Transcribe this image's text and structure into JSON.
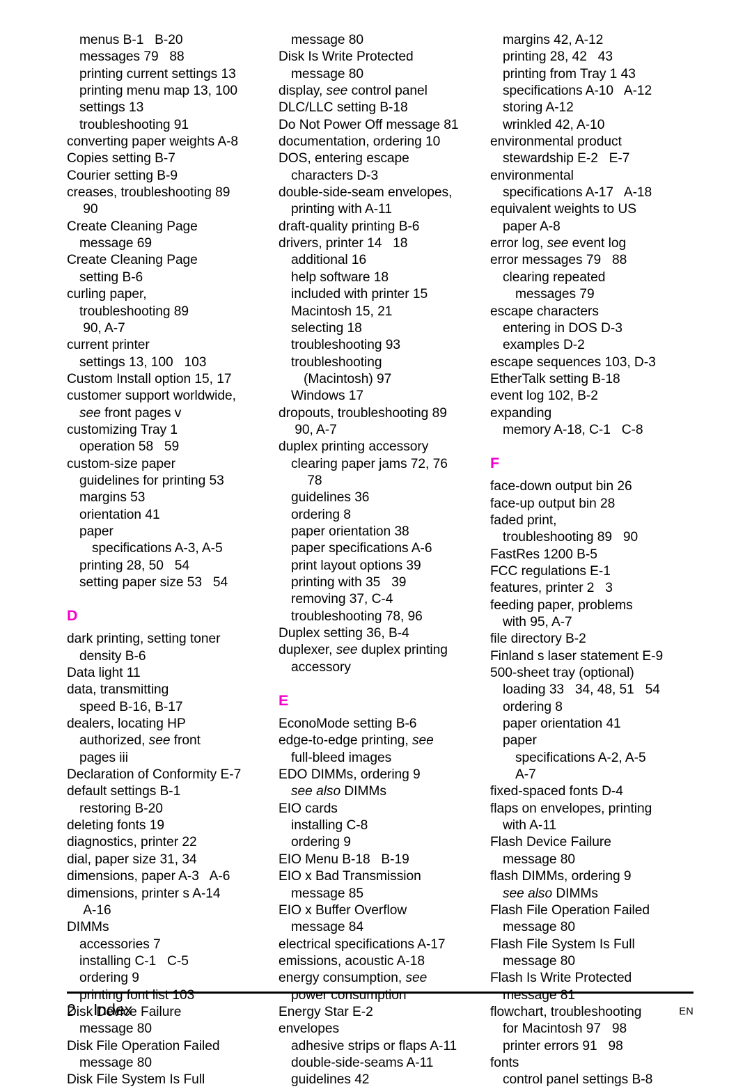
{
  "document": {
    "type": "index",
    "page_label": "Index",
    "page_number": "2",
    "language_code": "EN",
    "accent_color": "#f500c8"
  },
  "columns": [
    {
      "id": "column-1",
      "blocks": [
        {
          "kind": "entries",
          "entries": [
            {
              "level": 1,
              "text": "menus B-1   B-20"
            },
            {
              "level": 1,
              "text": "messages 79   88"
            },
            {
              "level": 1,
              "text": "printing current settings 13"
            },
            {
              "level": 1,
              "text": "printing menu map 13, 100"
            },
            {
              "level": 1,
              "text": "settings 13"
            },
            {
              "level": 1,
              "text": "troubleshooting 91"
            },
            {
              "level": 0,
              "text": "converting paper weights A-8"
            },
            {
              "level": 0,
              "text": "Copies setting B-7"
            },
            {
              "level": 0,
              "text": "Courier setting B-9"
            },
            {
              "level": 0,
              "text": "creases, troubleshooting 89"
            },
            {
              "level": 1,
              "text": " 90"
            },
            {
              "level": 0,
              "text": "Create Cleaning Page"
            },
            {
              "level": 1,
              "text": "message 69"
            },
            {
              "level": 0,
              "text": "Create Cleaning Page"
            },
            {
              "level": 1,
              "text": "setting B-6"
            },
            {
              "level": 0,
              "text": "curling paper,"
            },
            {
              "level": 1,
              "text": "troubleshooting 89"
            },
            {
              "level": 1,
              "text": " 90, A-7"
            },
            {
              "level": 0,
              "text": "current printer"
            },
            {
              "level": 1,
              "text": "settings 13, 100   103"
            },
            {
              "level": 0,
              "text": "Custom Install option 15, 17"
            },
            {
              "level": 0,
              "text": "customer support worldwide,"
            },
            {
              "level": 1,
              "text": "see front pages v",
              "italic_prefix": "see"
            },
            {
              "level": 0,
              "text": "customizing Tray 1"
            },
            {
              "level": 1,
              "text": "operation 58   59"
            },
            {
              "level": 0,
              "text": "custom-size paper"
            },
            {
              "level": 1,
              "text": "guidelines for printing 53"
            },
            {
              "level": 1,
              "text": "margins 53"
            },
            {
              "level": 1,
              "text": "orientation 41"
            },
            {
              "level": 1,
              "text": "paper"
            },
            {
              "level": 2,
              "text": "specifications A-3, A-5"
            },
            {
              "level": 1,
              "text": "printing 28, 50   54"
            },
            {
              "level": 1,
              "text": "setting paper size 53   54"
            }
          ]
        },
        {
          "kind": "letter",
          "letter": "D"
        },
        {
          "kind": "entries",
          "entries": [
            {
              "level": 0,
              "text": "dark printing, setting toner"
            },
            {
              "level": 1,
              "text": "density B-6"
            },
            {
              "level": 0,
              "text": "Data light 11"
            },
            {
              "level": 0,
              "text": "data, transmitting"
            },
            {
              "level": 1,
              "text": "speed B-16, B-17"
            },
            {
              "level": 0,
              "text": "dealers, locating HP"
            },
            {
              "level": 1,
              "text": "authorized, see front",
              "italic_word": "see"
            },
            {
              "level": 1,
              "text": "pages iii"
            },
            {
              "level": 0,
              "text": "Declaration of Conformity E-7"
            },
            {
              "level": 0,
              "text": "default settings B-1"
            },
            {
              "level": 1,
              "text": "restoring B-20"
            },
            {
              "level": 0,
              "text": "deleting fonts 19"
            },
            {
              "level": 0,
              "text": "diagnostics, printer 22"
            },
            {
              "level": 0,
              "text": "dial, paper size 31, 34"
            },
            {
              "level": 0,
              "text": "dimensions, paper A-3   A-6"
            },
            {
              "level": 0,
              "text": "dimensions, printer s A-14"
            },
            {
              "level": 1,
              "text": " A-16"
            },
            {
              "level": 0,
              "text": "DIMMs"
            },
            {
              "level": 1,
              "text": "accessories 7"
            },
            {
              "level": 1,
              "text": "installing C-1   C-5"
            },
            {
              "level": 1,
              "text": "ordering 9"
            },
            {
              "level": 1,
              "text": "printing font list 103"
            },
            {
              "level": 0,
              "text": "Disk Device Failure"
            },
            {
              "level": 1,
              "text": "message 80"
            },
            {
              "level": 0,
              "text": "Disk File Operation Failed"
            },
            {
              "level": 1,
              "text": "message 80"
            },
            {
              "level": 0,
              "text": "Disk File System Is Full"
            }
          ]
        }
      ]
    },
    {
      "id": "column-2",
      "blocks": [
        {
          "kind": "entries",
          "entries": [
            {
              "level": 1,
              "text": "message 80"
            },
            {
              "level": 0,
              "text": "Disk Is Write Protected"
            },
            {
              "level": 1,
              "text": "message 80"
            },
            {
              "level": 0,
              "text": "display, see control panel",
              "italic_word": "see"
            },
            {
              "level": 0,
              "text": "DLC/LLC setting B-18"
            },
            {
              "level": 0,
              "text": "Do Not Power Off message 81"
            },
            {
              "level": 0,
              "text": "documentation, ordering 10"
            },
            {
              "level": 0,
              "text": "DOS, entering escape"
            },
            {
              "level": 1,
              "text": "characters D-3"
            },
            {
              "level": 0,
              "text": "double-side-seam envelopes,"
            },
            {
              "level": 1,
              "text": "printing with A-11"
            },
            {
              "level": 0,
              "text": "draft-quality printing B-6"
            },
            {
              "level": 0,
              "text": "drivers, printer 14   18"
            },
            {
              "level": 1,
              "text": "additional 16"
            },
            {
              "level": 1,
              "text": "help software 18"
            },
            {
              "level": 1,
              "text": "included with printer 15"
            },
            {
              "level": 1,
              "text": "Macintosh 15, 21"
            },
            {
              "level": 1,
              "text": "selecting 18"
            },
            {
              "level": 1,
              "text": "troubleshooting 93"
            },
            {
              "level": 1,
              "text": "troubleshooting"
            },
            {
              "level": 2,
              "text": "(Macintosh) 97"
            },
            {
              "level": 1,
              "text": "Windows 17"
            },
            {
              "level": 0,
              "text": "dropouts, troubleshooting 89"
            },
            {
              "level": 1,
              "text": " 90, A-7"
            },
            {
              "level": 0,
              "text": "duplex printing accessory"
            },
            {
              "level": 1,
              "text": "clearing paper jams 72, 76"
            },
            {
              "level": 2,
              "text": " 78"
            },
            {
              "level": 1,
              "text": "guidelines 36"
            },
            {
              "level": 1,
              "text": "ordering 8"
            },
            {
              "level": 1,
              "text": "paper orientation 38"
            },
            {
              "level": 1,
              "text": "paper specifications A-6"
            },
            {
              "level": 1,
              "text": "print layout options 39"
            },
            {
              "level": 1,
              "text": "printing with 35   39"
            },
            {
              "level": 1,
              "text": "removing 37, C-4"
            },
            {
              "level": 1,
              "text": "troubleshooting 78, 96"
            },
            {
              "level": 0,
              "text": "Duplex setting 36, B-4"
            },
            {
              "level": 0,
              "text": "duplexer, see duplex printing",
              "italic_word": "see"
            },
            {
              "level": 1,
              "text": "accessory"
            }
          ]
        },
        {
          "kind": "letter",
          "letter": "E"
        },
        {
          "kind": "entries",
          "entries": [
            {
              "level": 0,
              "text": "EconoMode setting B-6"
            },
            {
              "level": 0,
              "text": "edge-to-edge printing, see",
              "italic_word": "see"
            },
            {
              "level": 1,
              "text": "full-bleed images"
            },
            {
              "level": 0,
              "text": "EDO DIMMs, ordering 9"
            },
            {
              "level": 1,
              "text": "see also DIMMs",
              "italic_phrase": "see also"
            },
            {
              "level": 0,
              "text": "EIO cards"
            },
            {
              "level": 1,
              "text": "installing C-8"
            },
            {
              "level": 1,
              "text": "ordering 9"
            },
            {
              "level": 0,
              "text": "EIO Menu B-18   B-19"
            },
            {
              "level": 0,
              "text": "EIO x Bad Transmission"
            },
            {
              "level": 1,
              "text": "message 85"
            },
            {
              "level": 0,
              "text": "EIO x Buffer Overflow"
            },
            {
              "level": 1,
              "text": "message 84"
            },
            {
              "level": 0,
              "text": "electrical specifications A-17"
            },
            {
              "level": 0,
              "text": "emissions, acoustic A-18"
            },
            {
              "level": 0,
              "text": "energy consumption, see",
              "italic_word": "see"
            },
            {
              "level": 1,
              "text": "power consumption"
            },
            {
              "level": 0,
              "text": "Energy Star E-2"
            },
            {
              "level": 0,
              "text": "envelopes"
            },
            {
              "level": 1,
              "text": "adhesive strips or flaps A-11"
            },
            {
              "level": 1,
              "text": "double-side-seams A-11"
            },
            {
              "level": 1,
              "text": "guidelines 42"
            }
          ]
        }
      ]
    },
    {
      "id": "column-3",
      "blocks": [
        {
          "kind": "entries",
          "entries": [
            {
              "level": 1,
              "text": "margins 42, A-12"
            },
            {
              "level": 1,
              "text": "printing 28, 42   43"
            },
            {
              "level": 1,
              "text": "printing from Tray 1 43"
            },
            {
              "level": 1,
              "text": "specifications A-10   A-12"
            },
            {
              "level": 1,
              "text": "storing A-12"
            },
            {
              "level": 1,
              "text": "wrinkled 42, A-10"
            },
            {
              "level": 0,
              "text": "environmental product"
            },
            {
              "level": 1,
              "text": "stewardship E-2   E-7"
            },
            {
              "level": 0,
              "text": "environmental"
            },
            {
              "level": 1,
              "text": "specifications A-17   A-18"
            },
            {
              "level": 0,
              "text": "equivalent weights to US"
            },
            {
              "level": 1,
              "text": "paper A-8"
            },
            {
              "level": 0,
              "text": "error log, see event log",
              "italic_word": "see"
            },
            {
              "level": 0,
              "text": "error messages 79   88"
            },
            {
              "level": 1,
              "text": "clearing repeated"
            },
            {
              "level": 2,
              "text": "messages 79"
            },
            {
              "level": 0,
              "text": "escape characters"
            },
            {
              "level": 1,
              "text": "entering in DOS D-3"
            },
            {
              "level": 1,
              "text": "examples D-2"
            },
            {
              "level": 0,
              "text": "escape sequences 103, D-3"
            },
            {
              "level": 0,
              "text": "EtherTalk setting B-18"
            },
            {
              "level": 0,
              "text": "event log 102, B-2"
            },
            {
              "level": 0,
              "text": "expanding"
            },
            {
              "level": 1,
              "text": "memory A-18, C-1   C-8"
            }
          ]
        },
        {
          "kind": "letter",
          "letter": "F"
        },
        {
          "kind": "entries",
          "entries": [
            {
              "level": 0,
              "text": "face-down output bin 26"
            },
            {
              "level": 0,
              "text": "face-up output bin 28"
            },
            {
              "level": 0,
              "text": "faded print,"
            },
            {
              "level": 1,
              "text": "troubleshooting 89   90"
            },
            {
              "level": 0,
              "text": "FastRes 1200 B-5"
            },
            {
              "level": 0,
              "text": "FCC regulations E-1"
            },
            {
              "level": 0,
              "text": "features, printer 2   3"
            },
            {
              "level": 0,
              "text": "feeding paper, problems"
            },
            {
              "level": 1,
              "text": "with 95, A-7"
            },
            {
              "level": 0,
              "text": "file directory B-2"
            },
            {
              "level": 0,
              "text": "Finland s laser statement E-9"
            },
            {
              "level": 0,
              "text": "500-sheet tray (optional)"
            },
            {
              "level": 1,
              "text": "loading 33   34, 48, 51   54"
            },
            {
              "level": 1,
              "text": "ordering 8"
            },
            {
              "level": 1,
              "text": "paper orientation 41"
            },
            {
              "level": 1,
              "text": "paper"
            },
            {
              "level": 2,
              "text": "specifications A-2, A-5"
            },
            {
              "level": 2,
              "text": "A-7"
            },
            {
              "level": 0,
              "text": "fixed-spaced fonts D-4"
            },
            {
              "level": 0,
              "text": "flaps on envelopes, printing"
            },
            {
              "level": 1,
              "text": "with A-11"
            },
            {
              "level": 0,
              "text": "Flash Device Failure"
            },
            {
              "level": 1,
              "text": "message 80"
            },
            {
              "level": 0,
              "text": "flash DIMMs, ordering 9"
            },
            {
              "level": 1,
              "text": "see also DIMMs",
              "italic_phrase": "see also"
            },
            {
              "level": 0,
              "text": "Flash File Operation Failed"
            },
            {
              "level": 1,
              "text": "message 80"
            },
            {
              "level": 0,
              "text": "Flash File System Is Full"
            },
            {
              "level": 1,
              "text": "message 80"
            },
            {
              "level": 0,
              "text": "Flash Is Write Protected"
            },
            {
              "level": 1,
              "text": "message 81"
            },
            {
              "level": 0,
              "text": "flowchart, troubleshooting"
            },
            {
              "level": 1,
              "text": "for Macintosh 97   98"
            },
            {
              "level": 1,
              "text": "printer errors 91   98"
            },
            {
              "level": 0,
              "text": "fonts"
            },
            {
              "level": 1,
              "text": "control panel settings B-8"
            }
          ]
        }
      ]
    }
  ]
}
